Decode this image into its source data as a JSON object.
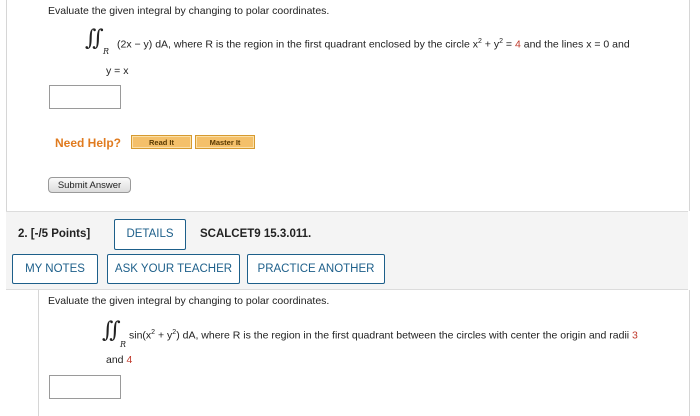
{
  "question1": {
    "prompt": "Evaluate the given integral by changing to polar coordinates.",
    "integral_symbol": "∬",
    "region_sub": "R",
    "integrand": "(2x − y) dA, where R is the region in the first quadrant enclosed by the circle x",
    "exp1": "2",
    "plus_y": " + y",
    "exp2": "2",
    "eq": " = ",
    "radius_val": "4",
    "tail": " and the lines x = 0 and",
    "line2": "y = x",
    "help": {
      "label": "Need Help?",
      "read_it": "Read It",
      "master_it": "Master It"
    },
    "submit": "Submit Answer"
  },
  "question2": {
    "number": "2.",
    "points": "[-/5 Points]",
    "details": "DETAILS",
    "code": "SCALCET9 15.3.011.",
    "my_notes": "MY NOTES",
    "ask_teacher": "ASK YOUR TEACHER",
    "practice": "PRACTICE ANOTHER",
    "prompt": "Evaluate the given integral by changing to polar coordinates.",
    "integral_symbol": "∬",
    "region_sub": "R",
    "integrand_a": "sin(x",
    "exp1": "2",
    "plus_y": " + y",
    "exp2": "2",
    "integrand_b": ") dA, where R is the region in the first quadrant between the circles with center the origin and radii ",
    "radius1": "3",
    "line2_prefix": "and ",
    "radius2": "4"
  },
  "colors": {
    "accent": "#1d5f8a",
    "help_orange": "#e07b1f",
    "value_red": "#c0392b"
  }
}
